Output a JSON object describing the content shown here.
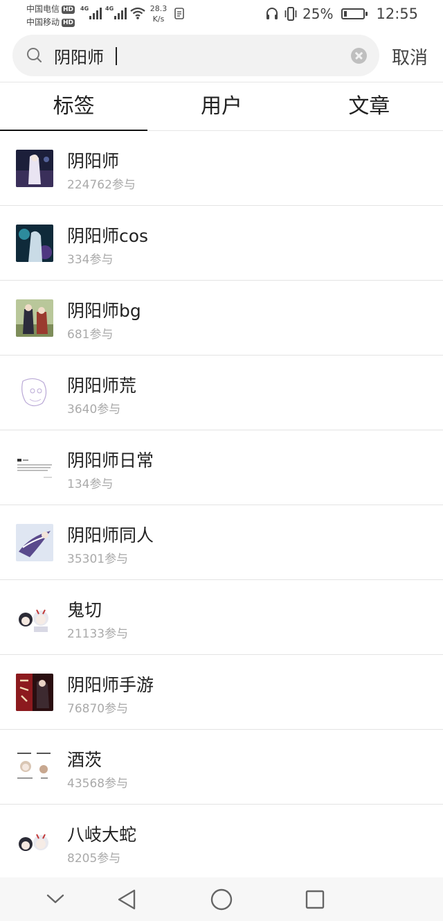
{
  "status_bar": {
    "carrier_1": "中国电信",
    "carrier_2": "中国移动",
    "hd_badge": "HD",
    "network_tag": "4G",
    "speed_value": "28.3",
    "speed_unit": "K/s",
    "battery_percent": "25%",
    "battery_level": 0.25,
    "time": "12:55"
  },
  "search": {
    "query": "阴阳师",
    "cancel_label": "取消"
  },
  "tabs": [
    {
      "label": "标签",
      "active": true
    },
    {
      "label": "用户",
      "active": false
    },
    {
      "label": "文章",
      "active": false
    }
  ],
  "tag_list": [
    {
      "name": "阴阳师",
      "count": "224762参与"
    },
    {
      "name": "阴阳师cos",
      "count": "334参与"
    },
    {
      "name": "阴阳师bg",
      "count": "681参与"
    },
    {
      "name": "阴阳师荒",
      "count": "3640参与"
    },
    {
      "name": "阴阳师日常",
      "count": "134参与"
    },
    {
      "name": "阴阳师同人",
      "count": "35301参与"
    },
    {
      "name": "鬼切",
      "count": "21133参与"
    },
    {
      "name": "阴阳师手游",
      "count": "76870参与"
    },
    {
      "name": "酒茨",
      "count": "43568参与"
    },
    {
      "name": "八岐大蛇",
      "count": "8205参与"
    }
  ],
  "colors": {
    "accent": "#111111",
    "muted_text": "#aaaaaa",
    "search_bg": "#f2f2f2",
    "nav_bg": "#f7f7f7"
  }
}
